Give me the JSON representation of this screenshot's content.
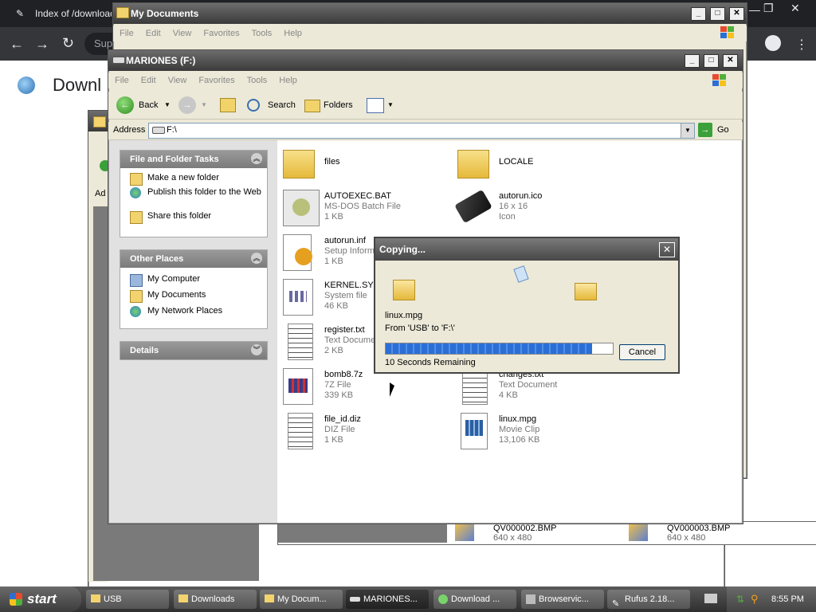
{
  "browser": {
    "tab_title": "Index of /download",
    "omnibox_partial": "Sup",
    "page_heading_partial": "Downl"
  },
  "win_mydocs": {
    "title": "My Documents",
    "menu": [
      "File",
      "Edit",
      "View",
      "Favorites",
      "Tools",
      "Help"
    ]
  },
  "win_back": {
    "address_partial": "Ad"
  },
  "win_bottom": {
    "files": [
      {
        "name": "QV000002.BMP",
        "sub": "640 x 480"
      },
      {
        "name": "QV000003.BMP",
        "sub": "640 x 480"
      }
    ]
  },
  "win_main": {
    "title": "MARIONES (F:)",
    "menu": [
      "File",
      "Edit",
      "View",
      "Favorites",
      "Tools",
      "Help"
    ],
    "toolbar": {
      "back": "Back",
      "search": "Search",
      "folders": "Folders"
    },
    "address_label": "Address",
    "address_value": "F:\\",
    "go": "Go",
    "panels": {
      "tasks": {
        "title": "File and Folder Tasks",
        "items": [
          "Make a new folder",
          "Publish this folder to the Web",
          "Share this folder"
        ]
      },
      "places": {
        "title": "Other Places",
        "items": [
          "My Computer",
          "My Documents",
          "My Network Places"
        ]
      },
      "details": {
        "title": "Details"
      }
    },
    "files": [
      {
        "name": "files",
        "sub": "",
        "sub2": "",
        "icon": "folder-icon"
      },
      {
        "name": "LOCALE",
        "sub": "",
        "sub2": "",
        "icon": "folder-icon"
      },
      {
        "name": "AUTOEXEC.BAT",
        "sub": "MS-DOS Batch File",
        "sub2": "1 KB",
        "icon": "batch-file-icon"
      },
      {
        "name": "autorun.ico",
        "sub": "16 x 16",
        "sub2": "Icon",
        "icon": "usb-drive-icon"
      },
      {
        "name": "autorun.inf",
        "sub": "Setup Informa",
        "sub2": "1 KB",
        "icon": "setup-file-icon"
      },
      {
        "name": "KERNEL.SYS",
        "sub": "System file",
        "sub2": "46 KB",
        "icon": "system-file-icon"
      },
      {
        "name": "register.txt",
        "sub": "Text Documen",
        "sub2": "2 KB",
        "icon": "text-file-icon"
      },
      {
        "name": "bomb8.7z",
        "sub": "7Z File",
        "sub2": "339 KB",
        "icon": "archive-file-icon"
      },
      {
        "name": "changes.txt",
        "sub": "Text Document",
        "sub2": "4 KB",
        "icon": "text-file-icon"
      },
      {
        "name": "file_id.diz",
        "sub": "DIZ File",
        "sub2": "1 KB",
        "icon": "text-file-icon"
      },
      {
        "name": "linux.mpg",
        "sub": "Movie Clip",
        "sub2": "13,106 KB",
        "icon": "movie-file-icon"
      }
    ]
  },
  "dialog": {
    "title": "Copying...",
    "filename": "linux.mpg",
    "from_to": "From 'USB' to 'F:\\'",
    "remaining": "10 Seconds Remaining",
    "progress": 0.91,
    "cancel": "Cancel"
  },
  "taskbar": {
    "start": "start",
    "tasks": [
      "USB",
      "Downloads",
      "My Docum...",
      "MARIONES...",
      "Download ...",
      "Browservic...",
      "Rufus 2.18..."
    ],
    "active_index": 3,
    "time": "8:55 PM"
  }
}
